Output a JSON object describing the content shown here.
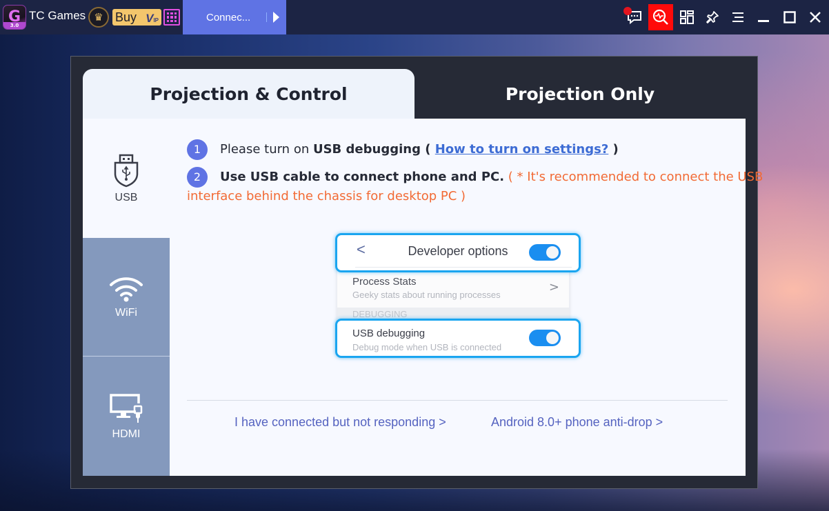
{
  "titlebar": {
    "logo_letter": "G",
    "logo_version": "3.0",
    "app_title": "TC Games",
    "buy_label": "Buy",
    "vip_label": "V",
    "vip_sub": "IP",
    "connect_tab_label": "Connec...",
    "buttons": [
      {
        "icon": "chat-notification-icon"
      },
      {
        "icon": "performance-monitor-icon",
        "active": true
      },
      {
        "icon": "layout-grid-icon"
      },
      {
        "icon": "pin-icon"
      },
      {
        "icon": "menu-icon"
      },
      {
        "icon": "minimize-icon"
      },
      {
        "icon": "maximize-icon"
      },
      {
        "icon": "close-icon"
      }
    ]
  },
  "tabs": {
    "active": "Projection & Control",
    "inactive": "Projection Only"
  },
  "sidebar": {
    "items": [
      {
        "label": "USB",
        "icon": "usb-icon",
        "selected": true
      },
      {
        "label": "WiFi",
        "icon": "wifi-icon",
        "selected": false
      },
      {
        "label": "HDMI",
        "icon": "hdmi-monitor-icon",
        "selected": false
      }
    ]
  },
  "steps": {
    "step1": {
      "num": "1",
      "prefix": "Please turn on ",
      "bold": "USB debugging",
      "open": " ( ",
      "link": "How to turn on settings?",
      "close": " )"
    },
    "step2": {
      "num": "2",
      "bold": "Use USB cable to connect phone and PC.",
      "note": " ( * It's recommended to connect the USB",
      "note_cont": "interface behind the chassis for desktop PC )"
    }
  },
  "illustration": {
    "back": "<",
    "developer_options": "Developer options",
    "developer_options_on": true,
    "process_stats_title": "Process Stats",
    "process_stats_sub": "Geeky stats about running processes",
    "chevron": ">",
    "debugging_header": "DEBUGGING",
    "usb_debugging_title": "USB debugging",
    "usb_debugging_sub": "Debug mode when USB is connected",
    "usb_debugging_on": true
  },
  "help_links": {
    "not_responding": "I have connected but not responding >",
    "anti_drop": "Android 8.0+ phone anti-drop >"
  },
  "colors": {
    "accent": "#5f73e4",
    "link": "#3d6cd4",
    "note": "#f26a34",
    "toggle": "#1a8ef0",
    "highlight": "#1aa5f0",
    "active_tool": "#ff0a0a",
    "sidebar_inactive": "#8499bd"
  }
}
